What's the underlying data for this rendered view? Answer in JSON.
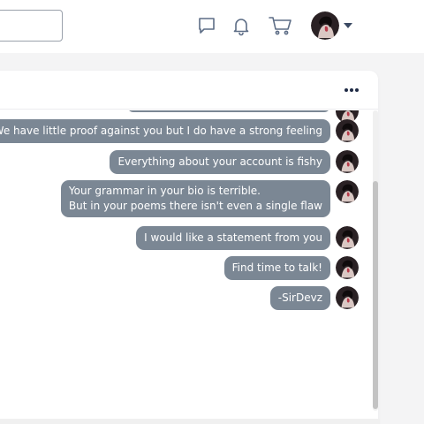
{
  "topbar": {
    "search": {
      "placeholder": "",
      "value": ""
    },
    "icons": [
      "chat-icon",
      "bell-icon",
      "cart-icon"
    ],
    "user_menu_icon": "caret-down-icon"
  },
  "chat": {
    "header_menu_icon": "more-dots-icon",
    "messages": [
      {
        "lines": [
          "We have little proof against you but I do have a strong feeling"
        ]
      },
      {
        "lines": [
          "Everything about your account is fishy"
        ]
      },
      {
        "lines": [
          "Your grammar in your bio is terrible.",
          "But in your poems there isn't even a single flaw"
        ]
      },
      {
        "lines": [
          "I would like a statement from you"
        ]
      },
      {
        "lines": [
          "Find time to talk!"
        ]
      },
      {
        "lines": [
          "-SirDevz"
        ]
      }
    ]
  },
  "colors": {
    "bubble": "#7b8794",
    "bubble_text": "#ffffff",
    "icon": "#5d6d86",
    "background": "#f4f4f5"
  }
}
